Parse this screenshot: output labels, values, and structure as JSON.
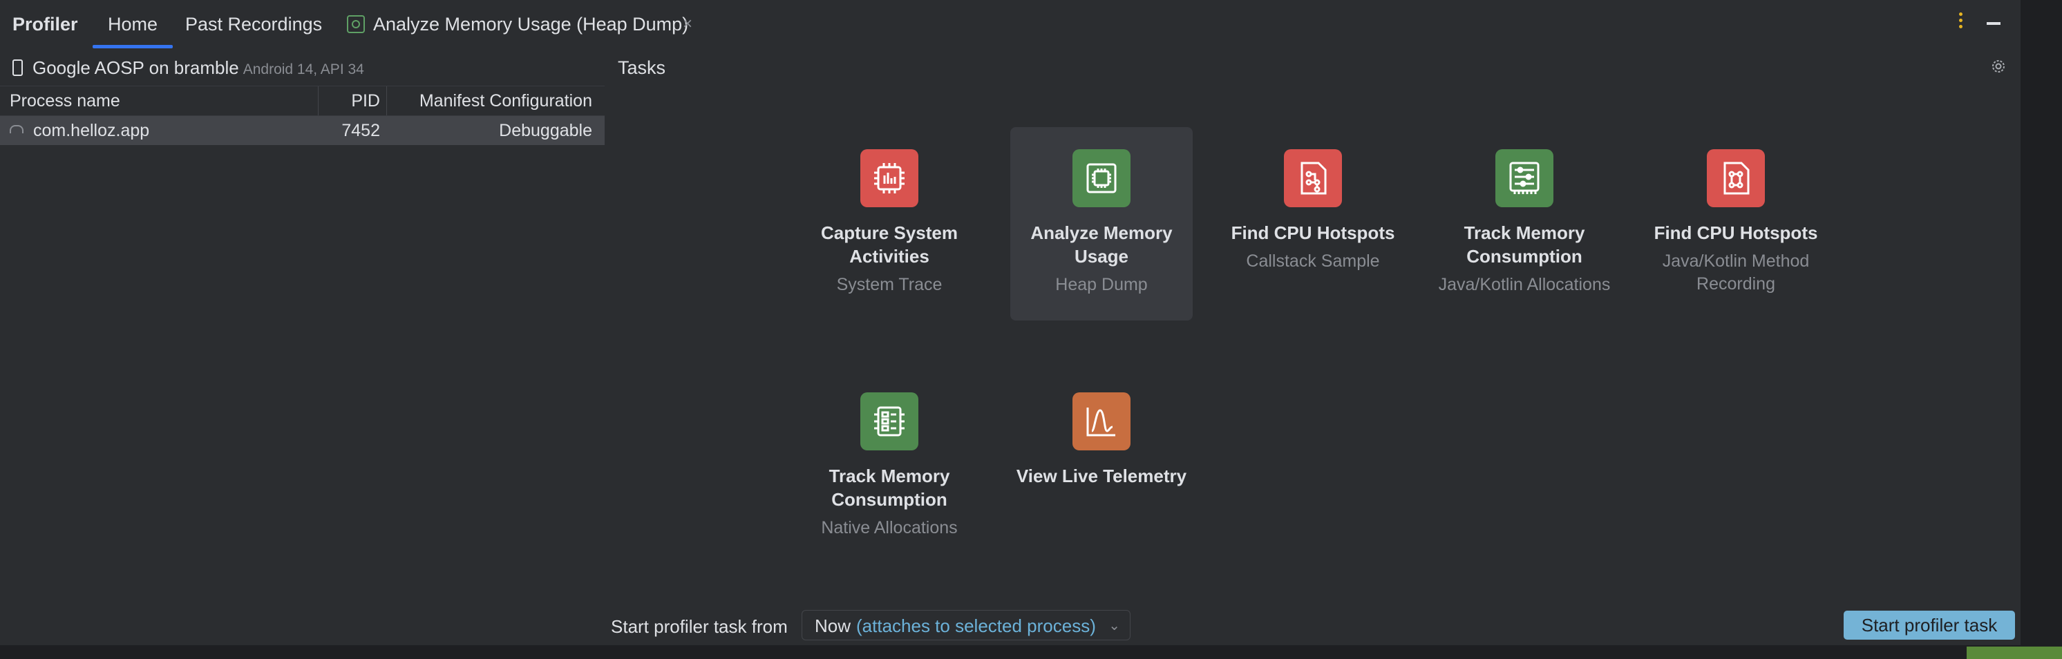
{
  "tabs": {
    "profiler": "Profiler",
    "home": "Home",
    "past": "Past Recordings",
    "heap": "Analyze Memory Usage (Heap Dump)",
    "close": "×"
  },
  "device": {
    "name": "Google AOSP on bramble",
    "os": "Android 14, API 34"
  },
  "process_table": {
    "headers": {
      "name": "Process name",
      "pid": "PID",
      "config": "Manifest Configuration"
    },
    "rows": [
      {
        "name": "com.helloz.app",
        "pid": "7452",
        "config": "Debuggable"
      }
    ]
  },
  "tasks": {
    "label": "Tasks",
    "items": [
      {
        "title": "Capture System Activities",
        "sub": "System Trace",
        "icon": "cpu-trace-icon",
        "color": "#d9534f"
      },
      {
        "title": "Analyze Memory Usage",
        "sub": "Heap Dump",
        "icon": "memory-chip-icon",
        "color": "#4f8a4f"
      },
      {
        "title": "Find CPU Hotspots",
        "sub": "Callstack Sample",
        "icon": "callstack-icon",
        "color": "#d9534f"
      },
      {
        "title": "Track Memory Consumption",
        "sub": "Java/Kotlin Allocations",
        "icon": "allocations-icon",
        "color": "#4f8a4f"
      },
      {
        "title": "Find CPU Hotspots",
        "sub": "Java/Kotlin Method Recording",
        "icon": "method-recording-icon",
        "color": "#d9534f"
      },
      {
        "title": "Track Memory Consumption",
        "sub": "Native Allocations",
        "icon": "native-allocations-icon",
        "color": "#4f8a4f"
      },
      {
        "title": "View Live Telemetry",
        "sub": "",
        "icon": "telemetry-icon",
        "color": "#c86e40"
      }
    ]
  },
  "footer": {
    "start_label": "Start profiler task from",
    "dropdown_value": "Now",
    "dropdown_hint": "(attaches to selected process)",
    "start_button": "Start profiler task"
  },
  "colors": {
    "accent": "#3574f0",
    "button": "#74b3d6",
    "link": "#6cb2d9"
  }
}
